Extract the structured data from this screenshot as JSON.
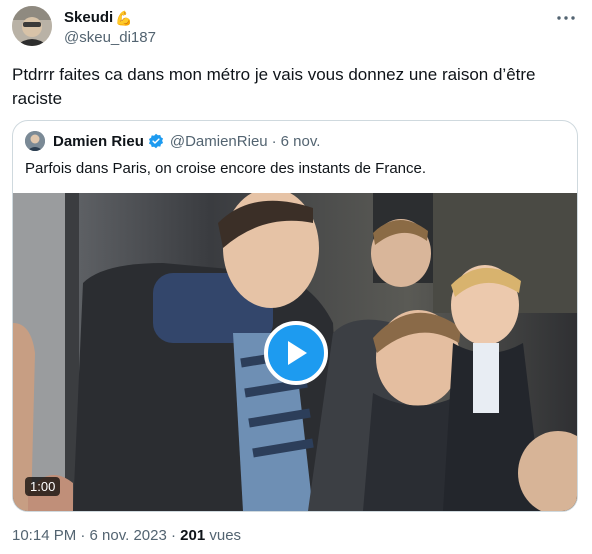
{
  "tweet": {
    "author_name": "Skeudi",
    "name_emoji": "💪",
    "handle": "@skeu_di187",
    "text": "Ptdrrr faites ca dans mon métro je vais vous donnez une raison d’être raciste",
    "timestamp": "10:14 PM · 6 nov. 2023",
    "separator": " · ",
    "views_count": "201",
    "views_label": "vues",
    "more_icon": "more-horizontal-icon"
  },
  "quote": {
    "author_name": "Damien Rieu",
    "verified_color": "#1d9bf0",
    "handle": "@DamienRieu",
    "dot": "·",
    "date": "6 nov.",
    "text": "Parfois dans Paris, on croise encore des instants de France.",
    "video": {
      "duration": "1:00",
      "play_icon": "play-icon",
      "accent": "#1d9bf0"
    }
  }
}
